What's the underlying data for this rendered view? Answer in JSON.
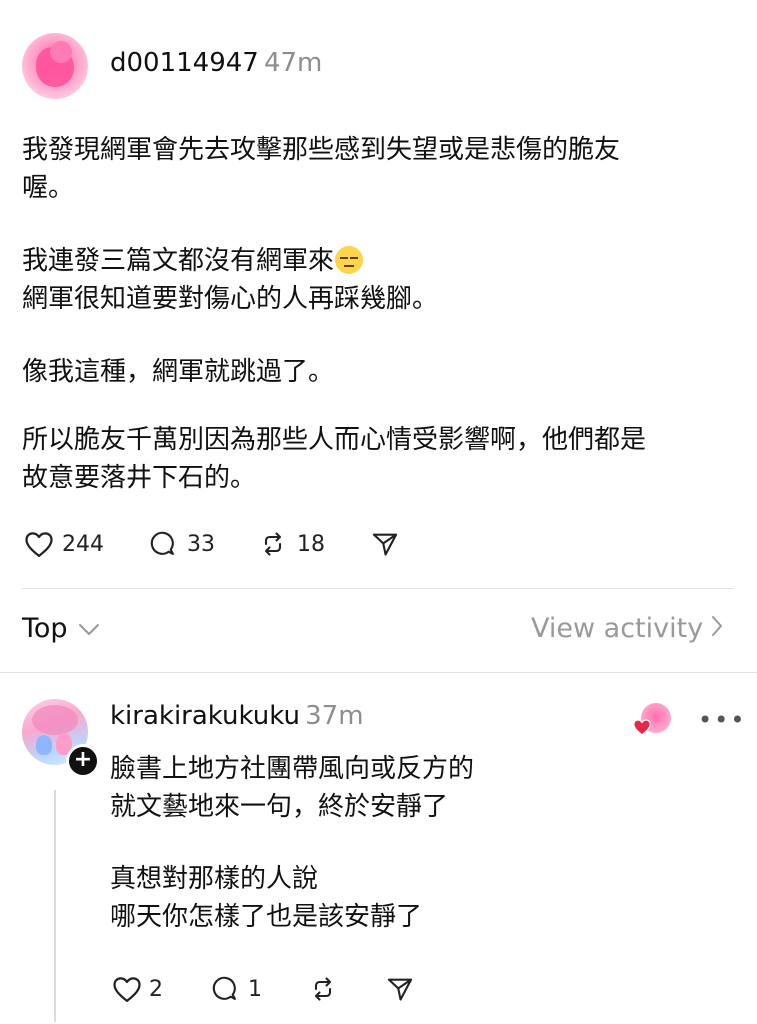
{
  "post": {
    "username": "d00114947",
    "time": "47m",
    "paragraphs": {
      "p1_l1": "我發現網軍會先去攻擊那些感到失望或是悲傷的脆友",
      "p1_l2": "喔。",
      "p2_l1": "我連發三篇文都沒有網軍來",
      "p2_l2": "網軍很知道要對傷心的人再踩幾腳。",
      "p3_l1": "像我這種，網軍就跳過了。",
      "p4_l1": "所以脆友千萬別因為那些人而心情受影響啊，他們都是",
      "p4_l2": "故意要落井下石的。"
    },
    "emoji": "expressionless-face",
    "likes": "244",
    "comments": "33",
    "reposts": "18"
  },
  "sort_bar": {
    "sort_label": "Top",
    "view_activity": "View activity"
  },
  "reply": {
    "username": "kirakirakukuku",
    "time": "37m",
    "lines": {
      "l1": "臉書上地方社團帶風向或反方的",
      "l2": "就文藝地來一句，終於安靜了",
      "l3": "真想對那樣的人說",
      "l4": "哪天你怎樣了也是該安靜了"
    },
    "likes": "2",
    "comments": "1"
  },
  "icons": {
    "like": "heart-icon",
    "comment": "comment-bubble-icon",
    "repost": "repost-icon",
    "share": "send-icon",
    "follow": "plus-icon",
    "more": "more-icon"
  },
  "colors": {
    "text": "#111111",
    "muted": "#8e8e8e",
    "divider": "#e3e3e3",
    "like_red": "#e8254b"
  }
}
